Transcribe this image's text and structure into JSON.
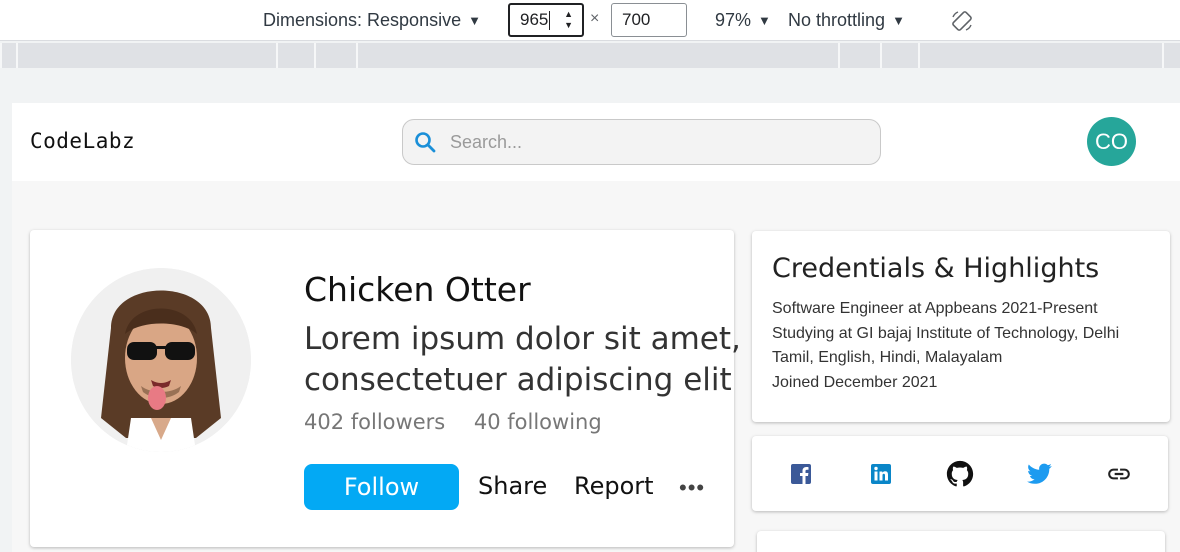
{
  "devtools": {
    "dimensions_label": "Dimensions: Responsive",
    "width_value": "965",
    "times": "×",
    "height_value": "700",
    "zoom": "97%",
    "throttling": "No throttling",
    "caret": "▼"
  },
  "app": {
    "logo": "CodeLabz",
    "search_placeholder": "Search...",
    "avatar_initials": "CO"
  },
  "profile": {
    "name": "Chicken Otter",
    "bio": "Lorem ipsum dolor sit amet, consectetuer adipiscing elit",
    "followers": "402 followers",
    "following": "40 following",
    "follow_label": "Follow",
    "share_label": "Share",
    "report_label": "Report",
    "more_label": "•••"
  },
  "credentials": {
    "title": "Credentials & Highlights",
    "items": [
      "Software Engineer at Appbeans 2021-Present",
      "Studying at GI bajaj Institute of Technology, Delhi",
      "Tamil, English, Hindi, Malayalam",
      "Joined December 2021"
    ]
  },
  "social": {
    "icons": [
      "facebook-icon",
      "linkedin-icon",
      "github-icon",
      "twitter-icon",
      "link-icon"
    ],
    "colors": {
      "facebook": "#3b5998",
      "linkedin": "#0a86c8",
      "github": "#111111",
      "twitter": "#1d9bf0",
      "link": "#222222"
    }
  },
  "colors": {
    "accent": "#03a9f4",
    "avatar": "#26a69a"
  }
}
